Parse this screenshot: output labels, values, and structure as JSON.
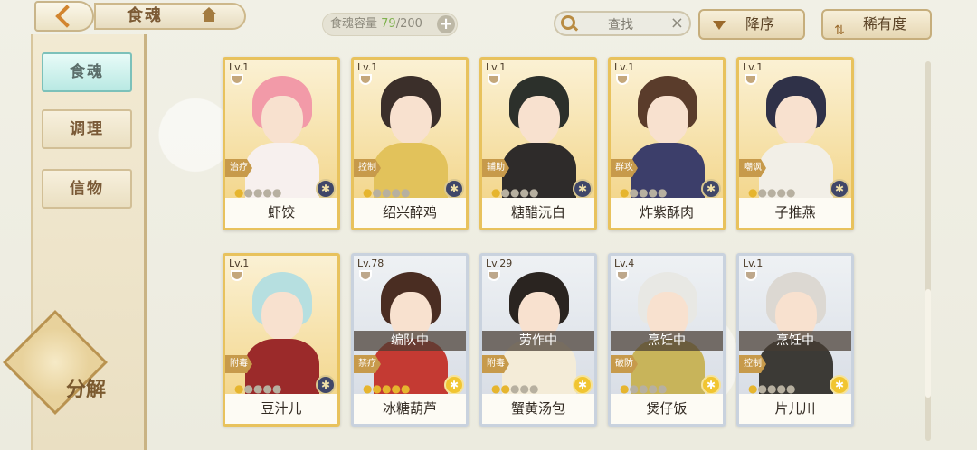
{
  "header": {
    "title": "食魂",
    "capacity_label": "食魂容量",
    "capacity_current": "79",
    "capacity_max": "/200",
    "capacity_add": "+",
    "search_placeholder": "查找",
    "search_clear": "×",
    "sort_order": "降序",
    "sort_by": "稀有度"
  },
  "sidebar": {
    "items": [
      {
        "label": "食魂",
        "active": true
      },
      {
        "label": "调理",
        "active": false
      },
      {
        "label": "信物",
        "active": false
      }
    ],
    "decompose": "分解"
  },
  "cards": [
    {
      "lv": "Lv.1",
      "role": "治疗",
      "name": "虾饺",
      "stars": 1,
      "status": "",
      "frame": "gold",
      "medal": "navy",
      "hair": "#f29aa8",
      "outfit": "#f7f0ee"
    },
    {
      "lv": "Lv.1",
      "role": "控制",
      "name": "绍兴醉鸡",
      "stars": 1,
      "status": "",
      "frame": "gold",
      "medal": "navy",
      "hair": "#3b2f2a",
      "outfit": "#e2c25b"
    },
    {
      "lv": "Lv.1",
      "role": "辅助",
      "name": "糖醋沅白",
      "stars": 1,
      "status": "",
      "frame": "gold",
      "medal": "navy",
      "hair": "#2c302b",
      "outfit": "#2e2b2a"
    },
    {
      "lv": "Lv.1",
      "role": "群攻",
      "name": "炸紫酥肉",
      "stars": 1,
      "status": "",
      "frame": "gold",
      "medal": "navy",
      "hair": "#5a3c2b",
      "outfit": "#3c3e6a"
    },
    {
      "lv": "Lv.1",
      "role": "嘲讽",
      "name": "子推燕",
      "stars": 1,
      "status": "",
      "frame": "gold",
      "medal": "navy",
      "hair": "#2f3148",
      "outfit": "#f2efe7"
    },
    {
      "lv": "Lv.1",
      "role": "附毒",
      "name": "豆汁儿",
      "stars": 1,
      "status": "",
      "frame": "gold",
      "medal": "navy",
      "hair": "#b6dfe0",
      "outfit": "#9b2a2a"
    },
    {
      "lv": "Lv.78",
      "role": "禁疗",
      "name": "冰糖葫芦",
      "stars": 5,
      "status": "编队中",
      "frame": "silver",
      "medal": "gold",
      "hair": "#4a2d22",
      "outfit": "#c43a33"
    },
    {
      "lv": "Lv.29",
      "role": "附毒",
      "name": "蟹黄汤包",
      "stars": 2,
      "status": "劳作中",
      "frame": "silver",
      "medal": "gold",
      "hair": "#2a2420",
      "outfit": "#f4ecd8"
    },
    {
      "lv": "Lv.4",
      "role": "破防",
      "name": "煲仔饭",
      "stars": 1,
      "status": "烹饪中",
      "frame": "silver",
      "medal": "gold",
      "hair": "#e8e8e4",
      "outfit": "#c8b45a"
    },
    {
      "lv": "Lv.1",
      "role": "控制",
      "name": "片儿川",
      "stars": 1,
      "status": "烹饪中",
      "frame": "silver",
      "medal": "gold",
      "hair": "#dcd8d2",
      "outfit": "#3c3a36"
    }
  ]
}
